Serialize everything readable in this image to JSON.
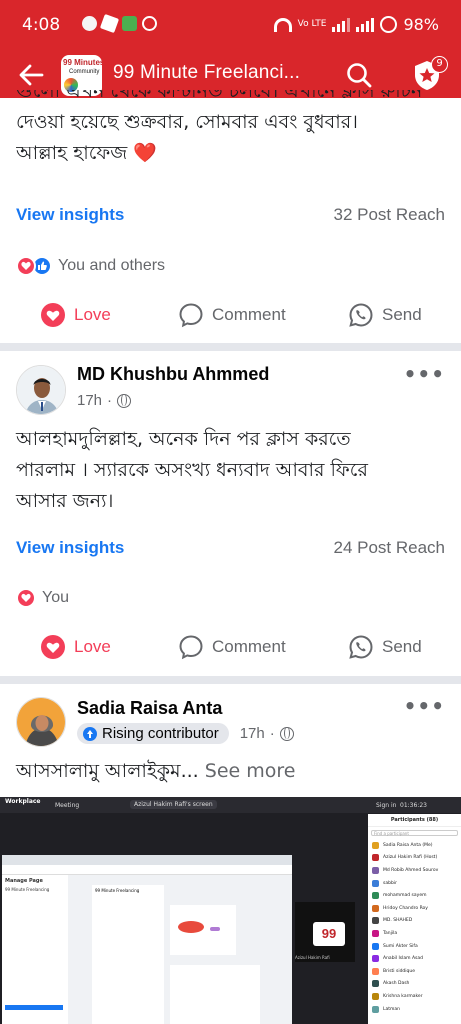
{
  "status_bar": {
    "time": "4:08",
    "network_label": "Vo LTE",
    "battery": "98%"
  },
  "header": {
    "title": "99 Minute Freelanci...",
    "logo_text": "99 Minutes Freelancing Community",
    "notification_count": "9"
  },
  "posts": [
    {
      "text_line_top": "গুলো এখন থেকে কন্টিনিউ চলবে। এখানে ক্লাস রুটিন",
      "text_line_2": "দেওয়া হয়েছে শুক্রবার, সোমবার এবং বুধবার।",
      "text_line_3": "আল্লাহ হাফেজ ❤️",
      "insights_label": "View insights",
      "reach": "32 Post Reach",
      "reactors": "You and others",
      "actions": {
        "love": "Love",
        "comment": "Comment",
        "send": "Send"
      }
    },
    {
      "author": "MD Khushbu Ahmmed",
      "time": "17h",
      "text_line_1": "আলহামদুলিল্লাহ, অনেক দিন পর ক্লাস করতে",
      "text_line_2": "পারলাম । স্যারকে অসংখ্য ধন্যবাদ আবার ফিরে",
      "text_line_3": "আসার জন্য।",
      "insights_label": "View insights",
      "reach": "24 Post Reach",
      "reactors": "You",
      "actions": {
        "love": "Love",
        "comment": "Comment",
        "send": "Send"
      }
    },
    {
      "author": "Sadia Raisa Anta",
      "badge": "Rising contributor",
      "time": "17h",
      "text": "আসসালামু আলাইকুম...",
      "see_more": "See more"
    }
  ],
  "embedded_screenshot": {
    "app_name": "Workplace",
    "meeting_label": "Meeting",
    "share_label": "Azizul Hakim Rafi's screen",
    "sign_in": "Sign in",
    "clock": "01:36:23",
    "page_title": "99 Minute Freelancing",
    "manage_page": "Manage Page",
    "participants_title": "Participants (88)",
    "find_placeholder": "Find a participant",
    "thumb_name": "Azizul Hakim Rafi",
    "participants": [
      "Sadia Raisa Anta (Me)",
      "Azizul Hakim Rafi (Host)",
      "Md Robib Ahmed Sourov",
      "sabbir",
      "mohammad sayem",
      "Hridoy Chandro Roy",
      "MD. SHAHED",
      "Tanjila",
      "Sumi Akter Sifa",
      "Anabil Islam Asad",
      "Bristi siddique",
      "Akash Dash",
      "Krishna karmaker",
      "Latman"
    ],
    "participant_colors": [
      "#e0a020",
      "#c0262b",
      "#7b5ea7",
      "#3b7dd8",
      "#2e8b57",
      "#d2691e",
      "#444444",
      "#c71585",
      "#1877f2",
      "#8a2be2",
      "#ff7f50",
      "#2f4f4f",
      "#b8860b",
      "#5f9ea0"
    ]
  },
  "colors": {
    "brand_red": "#d9262b",
    "link_blue": "#1877f2",
    "love_red": "#f33e58",
    "muted": "#65676b"
  }
}
